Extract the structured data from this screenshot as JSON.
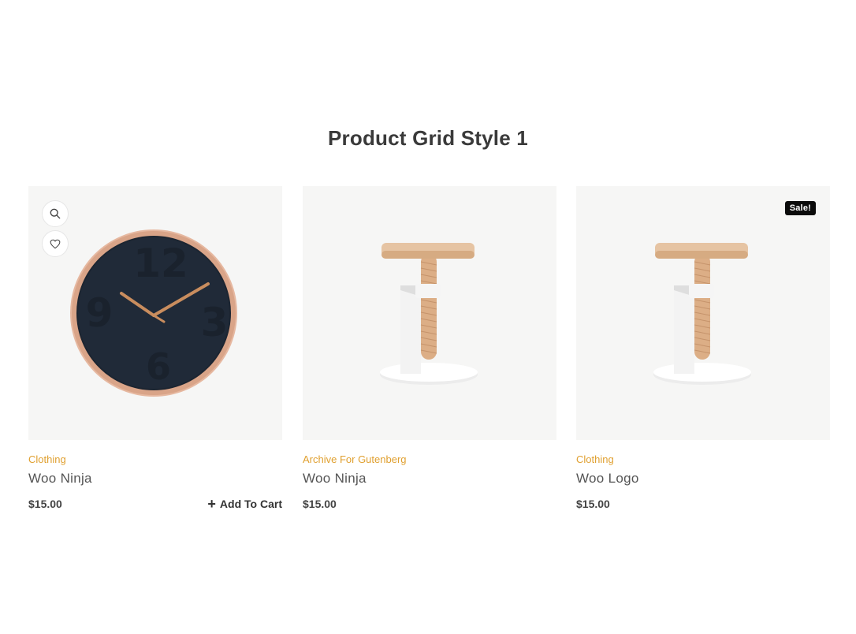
{
  "section": {
    "title": "Product Grid Style 1"
  },
  "products": [
    {
      "category": "Clothing",
      "name": "Woo Ninja",
      "price": "$15.00",
      "add_to_cart": "Add To Cart",
      "image": "wall-clock",
      "sale_badge": ""
    },
    {
      "category": "Archive For Gutenberg",
      "name": "Woo Ninja",
      "price": "$15.00",
      "image": "wooden-stool",
      "sale_badge": ""
    },
    {
      "category": "Clothing",
      "name": "Woo Logo",
      "price": "$15.00",
      "image": "wooden-stool",
      "sale_badge": "Sale!"
    }
  ],
  "icons": {
    "quick_view": "search-icon",
    "wishlist": "heart-icon",
    "add_to_cart": "plus-icon"
  },
  "colors": {
    "category": "#e0a030",
    "badge_bg": "#0b0b0b",
    "thumb_bg": "#f6f6f5"
  }
}
